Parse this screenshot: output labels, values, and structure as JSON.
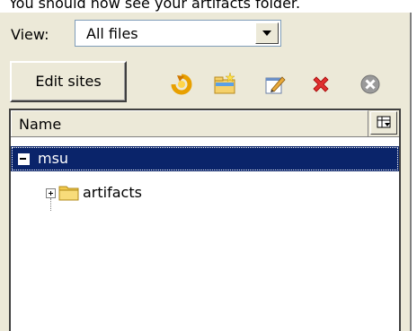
{
  "caption": "You should now see your artifacts folder.",
  "view": {
    "label": "View:",
    "selected": "All files"
  },
  "toolbar": {
    "edit_sites_label": "Edit sites",
    "icons": [
      "refresh-icon",
      "new-folder-icon",
      "edit-icon",
      "delete-icon",
      "stop-icon"
    ]
  },
  "tree": {
    "column_header": "Name",
    "root": {
      "label": "msu",
      "expanded": true,
      "selected": true
    },
    "children": [
      {
        "label": "artifacts",
        "expanded": false
      }
    ]
  },
  "colors": {
    "selection": "#0a246a",
    "panel": "#ece9d8"
  }
}
